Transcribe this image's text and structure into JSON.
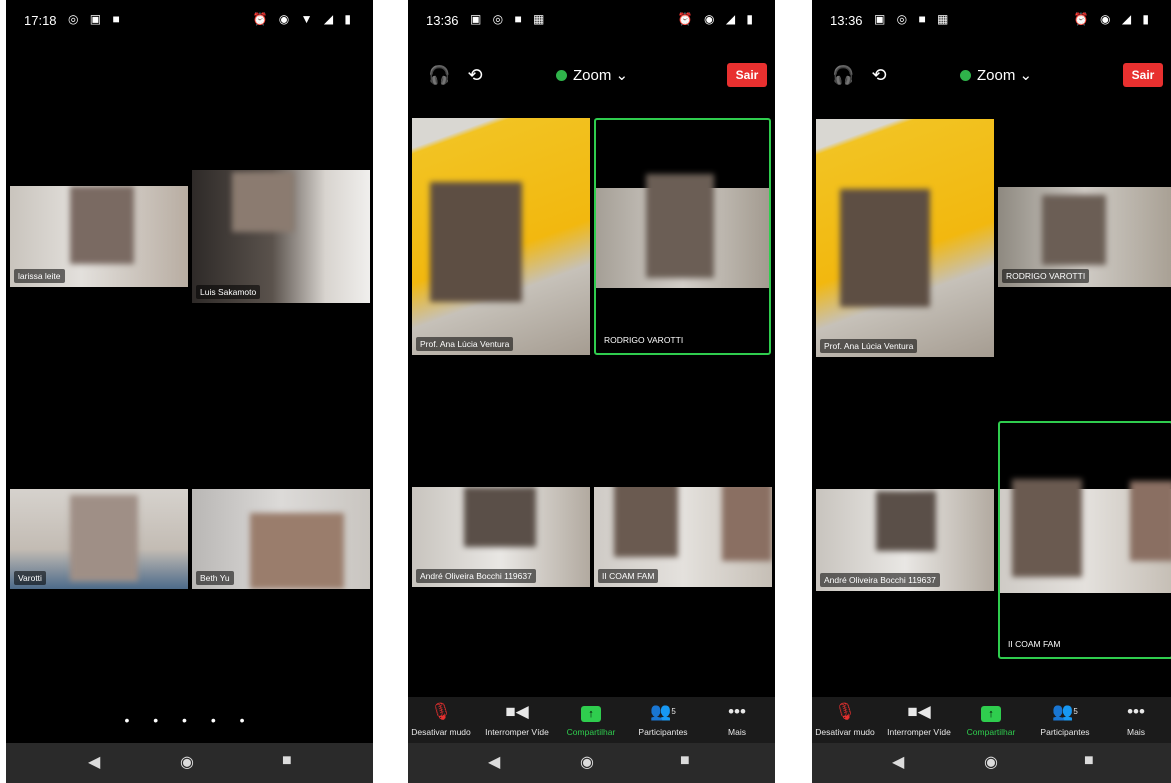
{
  "screen1": {
    "status_time": "17:18",
    "participants": [
      {
        "name": "larissa leite"
      },
      {
        "name": "Luis Sakamoto"
      },
      {
        "name": "Varotti"
      },
      {
        "name": "Beth Yu"
      }
    ],
    "pager_dots": "• • • • •"
  },
  "screen2": {
    "status_time": "13:36",
    "meeting_title": "Zoom",
    "leave_label": "Sair",
    "participants": [
      {
        "name": "Prof. Ana Lúcia Ventura"
      },
      {
        "name": "RODRIGO VAROTTI"
      },
      {
        "name": "André Oliveira Bocchi 119637"
      },
      {
        "name": "II COAM FAM"
      }
    ],
    "toolbar": {
      "mute": "Desativar mudo",
      "video": "Interromper Víde",
      "share": "Compartilhar",
      "participants": "Participantes",
      "participants_count": "5",
      "more": "Mais"
    }
  },
  "screen3": {
    "status_time": "13:36",
    "meeting_title": "Zoom",
    "leave_label": "Sair",
    "participants": [
      {
        "name": "Prof. Ana Lúcia Ventura"
      },
      {
        "name": "RODRIGO VAROTTI"
      },
      {
        "name": "André Oliveira Bocchi 119637"
      },
      {
        "name": "II COAM FAM"
      }
    ],
    "toolbar": {
      "mute": "Desativar mudo",
      "video": "Interromper Víde",
      "share": "Compartilhar",
      "participants": "Participantes",
      "participants_count": "5",
      "more": "Mais"
    }
  },
  "colors": {
    "active_speaker": "#2fcd4e",
    "leave_button": "#e8302f",
    "meeting_dot": "#2fb34a"
  },
  "icons": [
    "headset-icon",
    "camera-flip-icon",
    "chevron-down-icon",
    "mic-off-icon",
    "video-icon",
    "share-icon",
    "participants-icon",
    "more-icon",
    "nav-back-icon",
    "nav-home-icon",
    "nav-recent-icon"
  ]
}
